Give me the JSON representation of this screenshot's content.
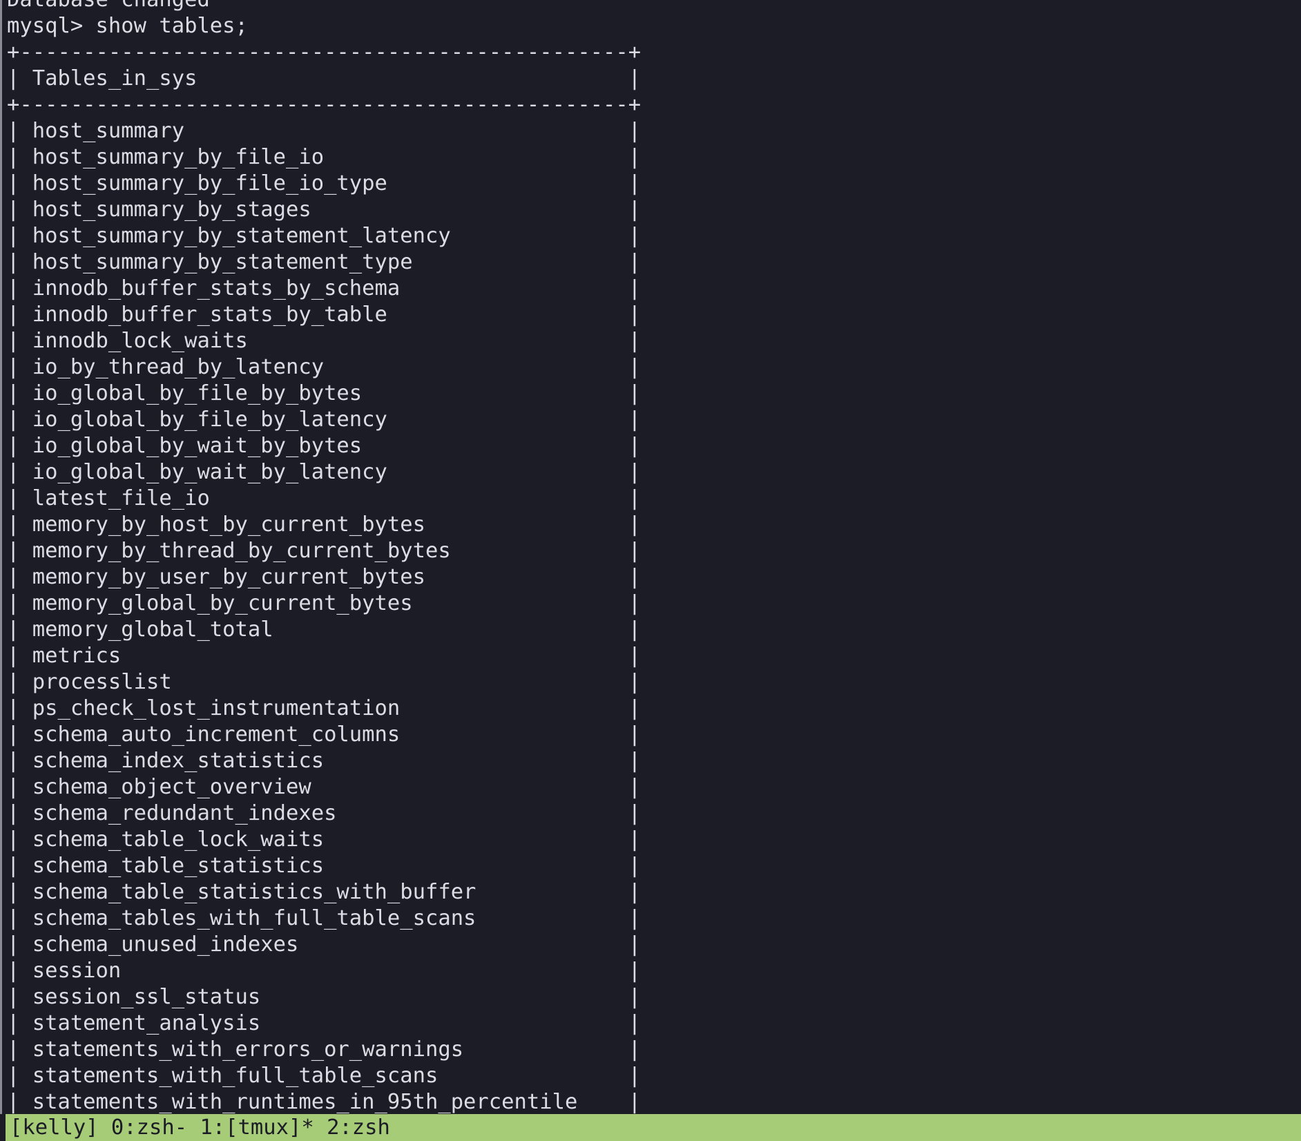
{
  "terminal": {
    "lines": [
      "Database changed",
      "mysql> show tables;",
      "+------------------------------------------------+",
      "| Tables_in_sys                                  |",
      "+------------------------------------------------+",
      "| host_summary                                   |",
      "| host_summary_by_file_io                        |",
      "| host_summary_by_file_io_type                   |",
      "| host_summary_by_stages                         |",
      "| host_summary_by_statement_latency              |",
      "| host_summary_by_statement_type                 |",
      "| innodb_buffer_stats_by_schema                  |",
      "| innodb_buffer_stats_by_table                   |",
      "| innodb_lock_waits                              |",
      "| io_by_thread_by_latency                        |",
      "| io_global_by_file_by_bytes                     |",
      "| io_global_by_file_by_latency                   |",
      "| io_global_by_wait_by_bytes                     |",
      "| io_global_by_wait_by_latency                   |",
      "| latest_file_io                                 |",
      "| memory_by_host_by_current_bytes                |",
      "| memory_by_thread_by_current_bytes              |",
      "| memory_by_user_by_current_bytes                |",
      "| memory_global_by_current_bytes                 |",
      "| memory_global_total                            |",
      "| metrics                                        |",
      "| processlist                                    |",
      "| ps_check_lost_instrumentation                  |",
      "| schema_auto_increment_columns                  |",
      "| schema_index_statistics                        |",
      "| schema_object_overview                         |",
      "| schema_redundant_indexes                       |",
      "| schema_table_lock_waits                        |",
      "| schema_table_statistics                        |",
      "| schema_table_statistics_with_buffer            |",
      "| schema_tables_with_full_table_scans            |",
      "| schema_unused_indexes                          |",
      "| session                                        |",
      "| session_ssl_status                             |",
      "| statement_analysis                             |",
      "| statements_with_errors_or_warnings             |",
      "| statements_with_full_table_scans               |",
      "| statements_with_runtimes_in_95th_percentile    |"
    ]
  },
  "statusbar": {
    "text": "[kelly] 0:zsh- 1:[tmux]* 2:zsh"
  },
  "colors": {
    "background": "#1c1c27",
    "foreground": "#dcdce4",
    "statusbar_bg": "#a6cc78",
    "statusbar_fg": "#1c1c27"
  }
}
